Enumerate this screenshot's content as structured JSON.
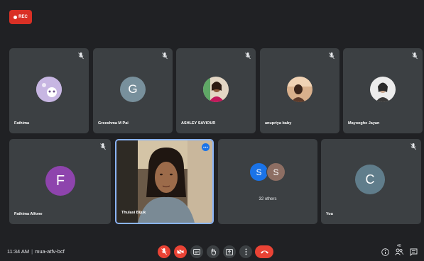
{
  "recording": {
    "label": "REC",
    "color": "#d93025"
  },
  "participants": [
    {
      "name": "Fathima",
      "avatar_type": "photo-icon",
      "avatar_bg": "#b7a4d6"
    },
    {
      "name": "Greeshma M Pai",
      "avatar_letter": "G",
      "avatar_bg": "#78909c"
    },
    {
      "name": "ASHLEY SAVIOUR",
      "avatar_type": "photo",
      "avatar_bg": "#d8c7b4"
    },
    {
      "name": "anupriya baby",
      "avatar_type": "photo",
      "avatar_bg": "#b88a5f"
    },
    {
      "name": "Mayooghe Jayan",
      "avatar_type": "photo",
      "avatar_bg": "#e6e6e6"
    },
    {
      "name": "Fathima Alfone",
      "avatar_letter": "F",
      "avatar_bg": "#8e44ad"
    },
    {
      "name": "Thulasi Bijuk",
      "video": true,
      "active_speaker": true
    }
  ],
  "others": {
    "letters": [
      "S",
      "S"
    ],
    "colors": [
      "#1a73e8",
      "#8d6e63"
    ],
    "label": "32 others"
  },
  "self": {
    "name": "You",
    "avatar_letter": "C",
    "avatar_bg": "#607d8b"
  },
  "bottom_bar": {
    "time": "11:34 AM",
    "meeting_code": "mua-atfv-bcf",
    "controls": [
      "mic-off-icon",
      "camera-off-icon",
      "captions-icon",
      "raise-hand-icon",
      "present-icon",
      "more-options-icon",
      "end-call-icon"
    ],
    "right_controls": [
      "info-icon",
      "people-icon",
      "chat-icon"
    ],
    "people_count": "40"
  },
  "colors": {
    "background": "#202124",
    "tile": "#3c4043",
    "active_border": "#8ab4f8",
    "danger": "#ea4335"
  }
}
